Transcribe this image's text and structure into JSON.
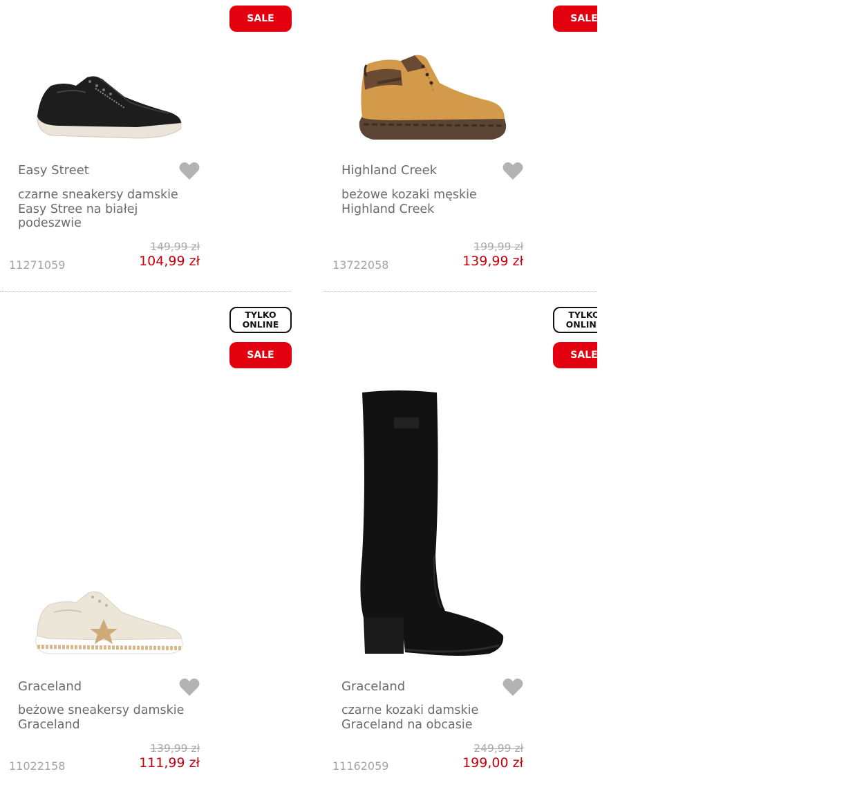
{
  "products": [
    {
      "brand": "Easy Street",
      "title": "czarne sneakersy damskie Easy Stree na białej podeszwie",
      "old_price": "149,99 zł",
      "price": "104,99 zł",
      "sku": "11271059",
      "badges": [
        "SALE"
      ],
      "image_icon": "black-sneaker-icon"
    },
    {
      "brand": "Highland Creek",
      "title": "beżowe kozaki męskie Highland Creek",
      "old_price": "199,99 zł",
      "price": "139,99 zł",
      "sku": "13722058",
      "badges": [
        "SALE"
      ],
      "image_icon": "tan-boot-icon"
    },
    {
      "brand": "Graceland",
      "title": "beżowe sneakersy damskie Graceland",
      "old_price": "139,99 zł",
      "price": "111,99 zł",
      "sku": "11022158",
      "badges": [
        "TYLKO\nONLINE",
        "SALE"
      ],
      "image_icon": "beige-sneaker-icon"
    },
    {
      "brand": "Graceland",
      "title": "czarne kozaki damskie Graceland na obcasie",
      "old_price": "249,99 zł",
      "price": "199,00 zł",
      "sku": "11162059",
      "badges": [
        "TYLKO\nONLINE",
        "SALE"
      ],
      "image_icon": "black-tall-boot-icon"
    }
  ],
  "colors": {
    "sale_red": "#e3000f",
    "price_red": "#c4000e",
    "text_gray": "#6b6b6b",
    "heart_gray": "#b3b3b3"
  }
}
